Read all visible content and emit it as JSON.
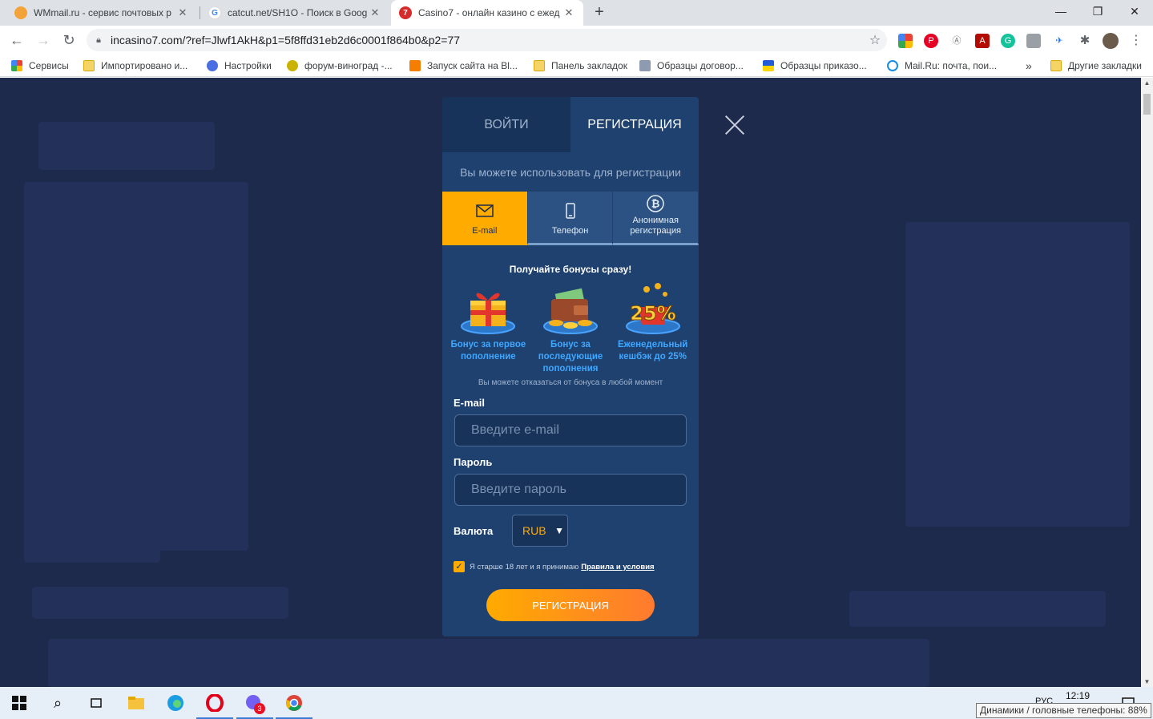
{
  "browser": {
    "tabs": [
      {
        "title": "WMmail.ru - сервис почтовых р",
        "favicon_color": "#f2a33a",
        "active": false
      },
      {
        "title": "catcut.net/SH1O - Поиск в Goog",
        "favicon_color": "#4285f4",
        "active": false
      },
      {
        "title": "Casino7 - онлайн казино с ежед",
        "favicon_color": "#d62b2b",
        "active": true
      }
    ],
    "new_tab_symbol": "+",
    "window_controls": {
      "minimize": "—",
      "maximize": "❐",
      "close": "✕"
    },
    "url": "incasino7.com/?ref=Jlwf1AkH&p1=5f8ffd31eb2d6c0001f864b0&p2=77"
  },
  "bookmarks": [
    {
      "label": "Сервисы",
      "icon": "apps-grid-icon"
    },
    {
      "label": "Импортировано и...",
      "icon": "folder-icon"
    },
    {
      "label": "Настройки",
      "icon": "gear-icon"
    },
    {
      "label": "форум-виноград -...",
      "icon": "grape-icon"
    },
    {
      "label": "Запуск сайта на Bl...",
      "icon": "blogger-icon"
    },
    {
      "label": "Панель закладок",
      "icon": "folder-icon"
    },
    {
      "label": "Образцы договор...",
      "icon": "pen-icon"
    },
    {
      "label": "Образцы приказо...",
      "icon": "ukraine-flag-icon"
    },
    {
      "label": "Mail.Ru: почта, пои...",
      "icon": "at-icon"
    },
    {
      "label": "»",
      "icon": "more-icon"
    },
    {
      "label": "Другие закладки",
      "icon": "folder-icon"
    }
  ],
  "modal": {
    "tab_login": "ВОЙТИ",
    "tab_register": "РЕГИСТРАЦИЯ",
    "subtitle": "Вы можете использовать для регистрации",
    "methods": [
      {
        "label": "E-mail",
        "icon": "envelope-icon"
      },
      {
        "label": "Телефон",
        "icon": "phone-icon"
      },
      {
        "label": "Анонимная регистрация",
        "icon": "bitcoin-icon"
      }
    ],
    "bonus_title": "Получайте бонусы сразу!",
    "bonuses": [
      {
        "label": "Бонус за первое пополнение",
        "icon": "gift-icon"
      },
      {
        "label": "Бонус за последующие пополнения",
        "icon": "wallet-coins-icon"
      },
      {
        "label": "Еженедельный кешбэк до 25%",
        "icon": "cashback-25-icon"
      }
    ],
    "bonus_note": "Вы можете отказаться от бонуса в любой момент",
    "email_label": "E-mail",
    "email_placeholder": "Введите e-mail",
    "password_label": "Пароль",
    "password_placeholder": "Введите пароль",
    "currency_label": "Валюта",
    "currency_value": "RUB",
    "terms_text": "Я старше 18 лет и я принимаю",
    "terms_link": "Правила и условия",
    "submit_label": "РЕГИСТРАЦИЯ"
  },
  "taskbar": {
    "time": "12:19",
    "lang": "РУС",
    "viber_badge": "3"
  },
  "tooltip": "Динамики / головные телефоны: 88%",
  "colors": {
    "accent": "#ffab00",
    "modal_bg": "#1e4170",
    "page_bg": "#1e2a4c",
    "link_blue": "#3fa7ff"
  }
}
